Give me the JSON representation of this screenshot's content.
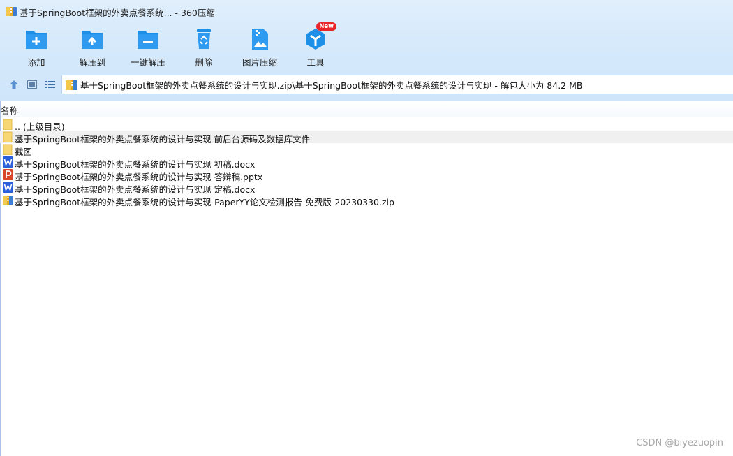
{
  "window": {
    "title": "基于SpringBoot框架的外卖点餐系统... - 360压缩"
  },
  "toolbar": {
    "items": [
      {
        "label": "添加",
        "icon": "add-folder-icon"
      },
      {
        "label": "解压到",
        "icon": "extract-to-icon"
      },
      {
        "label": "一键解压",
        "icon": "one-click-extract-icon"
      },
      {
        "label": "删除",
        "icon": "delete-bin-icon"
      },
      {
        "label": "图片压缩",
        "icon": "image-compress-icon"
      },
      {
        "label": "工具",
        "icon": "tools-cube-icon",
        "badge": "New"
      }
    ]
  },
  "address": {
    "path": "基于SpringBoot框架的外卖点餐系统的设计与实现.zip\\基于SpringBoot框架的外卖点餐系统的设计与实现 - 解包大小为 84.2 MB"
  },
  "columns": {
    "name": "名称"
  },
  "files": [
    {
      "name": ".. (上级目录)",
      "type": "folder"
    },
    {
      "name": "基于SpringBoot框架的外卖点餐系统的设计与实现 前后台源码及数据库文件",
      "type": "folder",
      "selected": true
    },
    {
      "name": "截图",
      "type": "folder"
    },
    {
      "name": "基于SpringBoot框架的外卖点餐系统的设计与实现 初稿.docx",
      "type": "word"
    },
    {
      "name": "基于SpringBoot框架的外卖点餐系统的设计与实现 答辩稿.pptx",
      "type": "powerpoint"
    },
    {
      "name": "基于SpringBoot框架的外卖点餐系统的设计与实现 定稿.docx",
      "type": "word"
    },
    {
      "name": "基于SpringBoot框架的外卖点餐系统的设计与实现-PaperYY论文检测报告-免费版-20230330.zip",
      "type": "zip"
    }
  ],
  "watermark": "CSDN @biyezuopin",
  "colors": {
    "accent_blue": "#1e8fe6",
    "chrome_bg": "#d6eafb",
    "new_badge": "#e8262a",
    "folder_yellow": "#f7d774",
    "word_blue": "#2b5fd9",
    "ppt_red": "#d9452b"
  }
}
